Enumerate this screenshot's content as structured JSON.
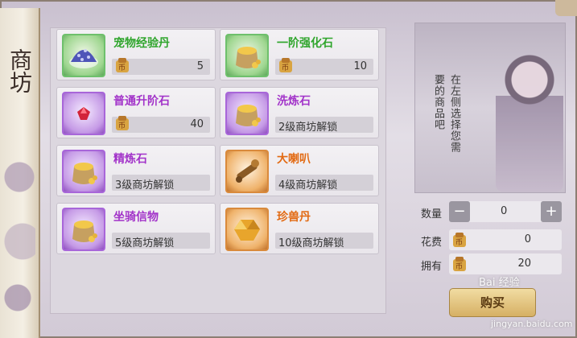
{
  "banner": {
    "title": "商坊"
  },
  "items": [
    {
      "name": "宠物经验丹",
      "name_color": "green",
      "icon": "pet-exp-pill-icon",
      "price": "5",
      "lock": null
    },
    {
      "name": "一阶强化石",
      "name_color": "green",
      "icon": "gold-sack-icon",
      "price": "10",
      "lock": null
    },
    {
      "name": "普通升阶石",
      "name_color": "purple",
      "icon": "red-gem-icon",
      "price": "40",
      "lock": null
    },
    {
      "name": "洗炼石",
      "name_color": "purple",
      "icon": "gold-sack-icon",
      "price": null,
      "lock": "2级商坊解锁"
    },
    {
      "name": "精炼石",
      "name_color": "purple",
      "icon": "gold-sack-icon",
      "price": null,
      "lock": "3级商坊解锁"
    },
    {
      "name": "大喇叭",
      "name_color": "orange",
      "icon": "trumpet-scroll-icon",
      "price": null,
      "lock": "4级商坊解锁"
    },
    {
      "name": "坐骑信物",
      "name_color": "purple",
      "icon": "gold-sack-icon",
      "price": null,
      "lock": "5级商坊解锁"
    },
    {
      "name": "珍兽丹",
      "name_color": "orange",
      "icon": "gold-gem-icon",
      "price": null,
      "lock": "10级商坊解锁"
    }
  ],
  "portrait": {
    "hint": "在左侧选择您需要的商品吧"
  },
  "purchase": {
    "quantity_label": "数量",
    "quantity_value": "0",
    "minus": "−",
    "plus": "+",
    "cost_label": "花费",
    "cost_value": "0",
    "owned_label": "拥有",
    "owned_value": "20",
    "buy_label": "购买"
  },
  "watermark": {
    "text": "Bai 经验",
    "url": "jingyan.baidu.com"
  },
  "colors": {
    "green": "#2fa52c",
    "purple": "#a233c9",
    "orange": "#e26a12"
  }
}
